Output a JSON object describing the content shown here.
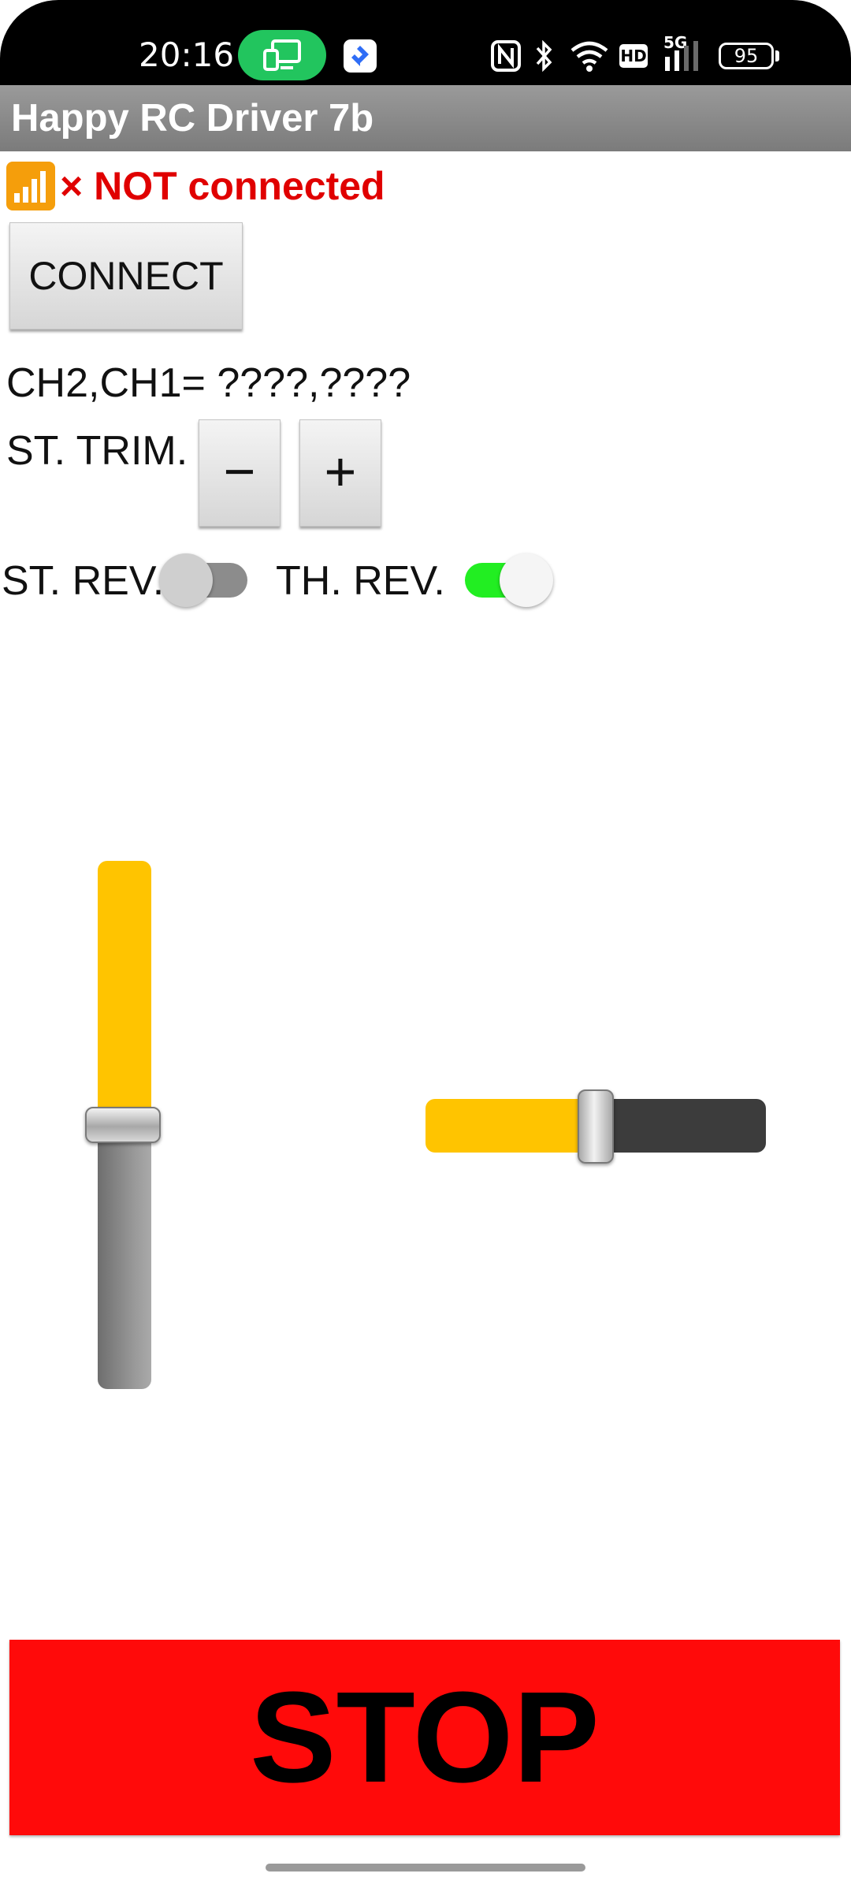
{
  "status_bar": {
    "time": "20:16",
    "battery_level": "95",
    "network_type": "5G",
    "hd_badge": "HD",
    "icons": [
      "screen-cast-icon",
      "app-notification-icon",
      "nfc-icon",
      "bluetooth-icon",
      "wifi-icon",
      "hd-icon",
      "cellular-signal-icon",
      "battery-icon"
    ]
  },
  "app": {
    "title": "Happy RC Driver 7b"
  },
  "connection": {
    "icon": "signal-bars-icon",
    "status_text": "× NOT connected",
    "status_color": "#e00000",
    "connect_label": "CONNECT"
  },
  "channels": {
    "readout": "CH2,CH1= ????,????"
  },
  "trim": {
    "label": "ST. TRIM.",
    "minus_label": "−",
    "plus_label": "+"
  },
  "reverse": {
    "steering_label": "ST. REV.",
    "steering_on": false,
    "throttle_label": "TH. REV.",
    "throttle_on": true
  },
  "throttle_slider": {
    "value": 0.5,
    "fill_color": "#ffc400"
  },
  "steering_slider": {
    "value": 0.5,
    "fill_color": "#ffc400"
  },
  "stop_button": {
    "label": "STOP",
    "color": "#ff0a0a"
  }
}
